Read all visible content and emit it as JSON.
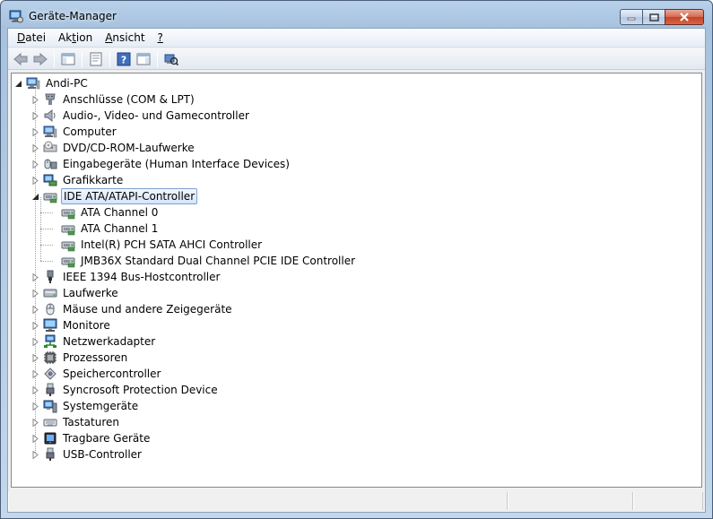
{
  "window": {
    "title": "Geräte-Manager"
  },
  "menu": [
    {
      "pre": "",
      "u": "D",
      "post": "atei"
    },
    {
      "pre": "Ak",
      "u": "t",
      "post": "ion"
    },
    {
      "pre": "",
      "u": "A",
      "post": "nsicht"
    },
    {
      "pre": "",
      "u": "?",
      "post": ""
    }
  ],
  "toolbar": [
    "back-icon",
    "forward-icon",
    "show-hide-console-tree-icon",
    "properties-icon",
    "help-icon",
    "show-action-pane-icon",
    "scan-hardware-icon"
  ],
  "tree": {
    "root": {
      "label": "Andi-PC",
      "icon": "computer-icon"
    },
    "categories": [
      {
        "label": "Anschlüsse (COM & LPT)",
        "icon": "port-icon",
        "expanded": false
      },
      {
        "label": "Audio-, Video- und Gamecontroller",
        "icon": "speaker-icon",
        "expanded": false
      },
      {
        "label": "Computer",
        "icon": "computer-icon",
        "expanded": false
      },
      {
        "label": "DVD/CD-ROM-Laufwerke",
        "icon": "dvd-drive-icon",
        "expanded": false
      },
      {
        "label": "Eingabegeräte (Human Interface Devices)",
        "icon": "hid-icon",
        "expanded": false
      },
      {
        "label": "Grafikkarte",
        "icon": "display-adapter-icon",
        "expanded": false
      },
      {
        "label": "IDE ATA/ATAPI-Controller",
        "icon": "ide-controller-icon",
        "expanded": true,
        "selected": true,
        "children": [
          {
            "label": "ATA Channel 0",
            "icon": "ide-controller-icon"
          },
          {
            "label": "ATA Channel 1",
            "icon": "ide-controller-icon"
          },
          {
            "label": "Intel(R) PCH SATA AHCI Controller",
            "icon": "ide-controller-icon"
          },
          {
            "label": "JMB36X Standard Dual Channel PCIE IDE Controller",
            "icon": "ide-controller-icon"
          }
        ]
      },
      {
        "label": "IEEE 1394 Bus-Hostcontroller",
        "icon": "firewire-icon",
        "expanded": false
      },
      {
        "label": "Laufwerke",
        "icon": "disk-drive-icon",
        "expanded": false
      },
      {
        "label": "Mäuse und andere Zeigegeräte",
        "icon": "mouse-icon",
        "expanded": false
      },
      {
        "label": "Monitore",
        "icon": "monitor-icon",
        "expanded": false
      },
      {
        "label": "Netzwerkadapter",
        "icon": "network-adapter-icon",
        "expanded": false
      },
      {
        "label": "Prozessoren",
        "icon": "processor-icon",
        "expanded": false
      },
      {
        "label": "Speichercontroller",
        "icon": "storage-controller-icon",
        "expanded": false
      },
      {
        "label": "Syncrosoft Protection Device",
        "icon": "usb-plug-icon",
        "expanded": false
      },
      {
        "label": "Systemgeräte",
        "icon": "system-devices-icon",
        "expanded": false
      },
      {
        "label": "Tastaturen",
        "icon": "keyboard-icon",
        "expanded": false
      },
      {
        "label": "Tragbare Geräte",
        "icon": "portable-device-icon",
        "expanded": false
      },
      {
        "label": "USB-Controller",
        "icon": "usb-plug-icon",
        "expanded": false
      }
    ]
  },
  "colors": {
    "selection_border": "#7da2ce",
    "selection_fill": "#d3e5fb",
    "close_button": "#c24525"
  }
}
